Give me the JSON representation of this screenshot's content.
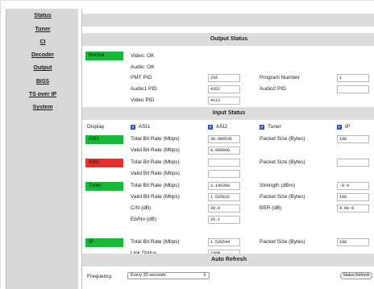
{
  "nav": [
    "Status",
    "Tuner",
    "CI",
    "Decoder",
    "Output",
    "BISS",
    "TS over IP",
    "System"
  ],
  "colors": {
    "ok": "#19b83a",
    "error": "#e8302a",
    "band": "#dcdcdc"
  },
  "output_status": {
    "title": "Output Status",
    "state": "Normal",
    "video": "Video: OK",
    "audio": "Audio: OK",
    "pmt_pid_label": "PMT PID",
    "pmt_pid": "256",
    "program_number_label": "Program Number",
    "program_number": "1",
    "audio1_pid_label": "Audio1 PID",
    "audio1_pid": "4352",
    "audio2_pid_label": "Audio2 PID",
    "audio2_pid": "",
    "video_pid_label": "Video PID",
    "video_pid": "4113"
  },
  "input_status": {
    "title": "Input Status",
    "display_label": "Display",
    "display_options": [
      "ASI1",
      "ASI2",
      "Tuner",
      "IP"
    ],
    "asi1": {
      "tag": "ASI1",
      "total_bit_rate_label": "Total Bit Rate (Mbps)",
      "total_bit_rate": "39.999536",
      "packet_size_label": "Packet Size (Bytes)",
      "packet_size": "188",
      "valid_bit_rate_label": "Valid Bit Rate (Mbps)",
      "valid_bit_rate": "0.000000"
    },
    "asi2": {
      "tag": "ASI2",
      "total_bit_rate_label": "Total Bit Rate (Mbps)",
      "total_bit_rate": "",
      "packet_size_label": "Packet Size (Bytes)",
      "packet_size": "",
      "valid_bit_rate_label": "Valid Bit Rate (Mbps)",
      "valid_bit_rate": ""
    },
    "tuner": {
      "tag": "Tuner",
      "total_bit_rate_label": "Total Bit Rate (Mbps)",
      "total_bit_rate": "3.146368",
      "strength_label": "Strength (dBm)",
      "strength": "-8.0",
      "valid_bit_rate_label": "Valid Bit Rate (Mbps)",
      "valid_bit_rate": "1.525032",
      "packet_size_label": "Packet Size (Bytes)",
      "packet_size": "188",
      "cn_label": "C/N (dB)",
      "cn": "30.9",
      "ber_label": "BER (dB)",
      "ber": "0.0e-8",
      "ebno_label": "Eb/No (dB)",
      "ebno": "26.1"
    },
    "ip": {
      "tag": "IP",
      "total_bit_rate_label": "Total Bit Rate (Mbps)",
      "total_bit_rate": "1.520544",
      "packet_size_label": "Packet Size (Bytes)",
      "packet_size": "188",
      "link_status_label": "Link Status",
      "link_status": "100M"
    }
  },
  "auto_refresh": {
    "title": "Auto Refresh",
    "frequency_label": "Frequency",
    "frequency_value": "Every 20 seconds",
    "button_label": "Status Refresh"
  }
}
